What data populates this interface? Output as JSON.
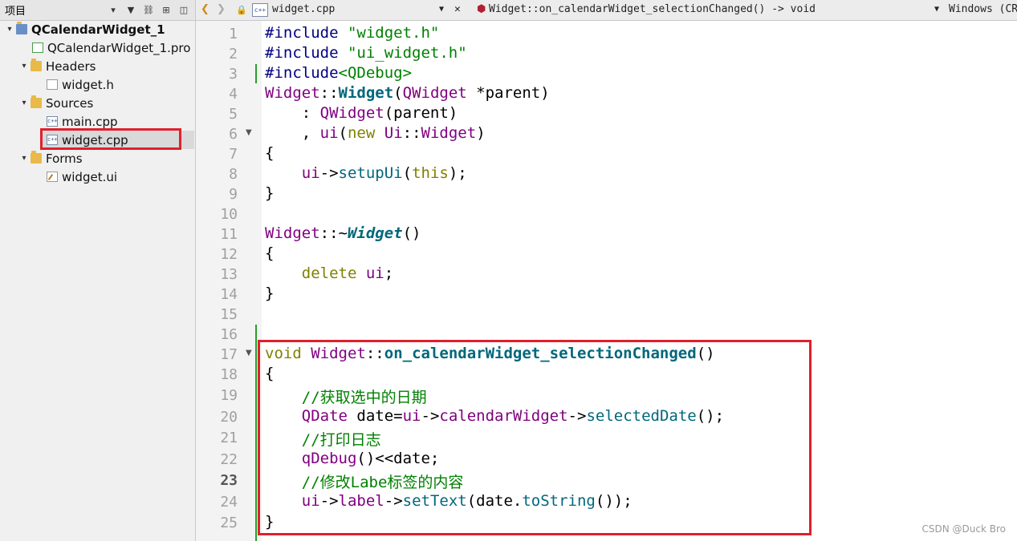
{
  "project_panel": {
    "title": "项目",
    "tree": [
      {
        "label": "QCalendarWidget_1",
        "icon": "project-icon",
        "arrow": "▾"
      },
      {
        "label": "QCalendarWidget_1.pro",
        "icon": "pro-file-icon"
      },
      {
        "label": "Headers",
        "icon": "folder-icon",
        "arrow": "▾"
      },
      {
        "label": "widget.h",
        "icon": "header-file-icon"
      },
      {
        "label": "Sources",
        "icon": "folder-icon",
        "arrow": "▾"
      },
      {
        "label": "main.cpp",
        "icon": "cpp-file-icon"
      },
      {
        "label": "widget.cpp",
        "icon": "cpp-file-icon"
      },
      {
        "label": "Forms",
        "icon": "folder-icon",
        "arrow": "▾"
      },
      {
        "label": "widget.ui",
        "icon": "ui-file-icon"
      }
    ]
  },
  "editor": {
    "file_name": "widget.cpp",
    "function": "Widget::on_calendarWidget_selectionChanged() -> void",
    "encoding": "Windows (CR",
    "current_line": "23",
    "line_numbers": [
      "1",
      "2",
      "3",
      "4",
      "5",
      "6",
      "7",
      "8",
      "9",
      "10",
      "11",
      "12",
      "13",
      "14",
      "15",
      "16",
      "17",
      "18",
      "19",
      "20",
      "21",
      "22",
      "23",
      "24",
      "25"
    ],
    "code": {
      "l1_a": "#include ",
      "l1_b": "\"widget.h\"",
      "l2_a": "#include ",
      "l2_b": "\"ui_widget.h\"",
      "l3_a": "#include",
      "l3_b": "<QDebug>",
      "l4_a": "Widget",
      "l4_b": "::",
      "l4_c": "Widget",
      "l4_d": "(",
      "l4_e": "QWidget",
      "l4_f": " *parent)",
      "l5_a": "    : ",
      "l5_b": "QWidget",
      "l5_c": "(parent)",
      "l6_a": "    , ",
      "l6_b": "ui",
      "l6_c": "(",
      "l6_d": "new",
      "l6_e": " ",
      "l6_f": "Ui",
      "l6_g": "::",
      "l6_h": "Widget",
      "l6_i": ")",
      "l7": "{",
      "l8_a": "    ",
      "l8_b": "ui",
      "l8_c": "->",
      "l8_d": "setupUi",
      "l8_e": "(",
      "l8_f": "this",
      "l8_g": ");",
      "l9": "}",
      "l11_a": "Widget",
      "l11_b": "::~",
      "l11_c": "Widget",
      "l11_d": "()",
      "l12": "{",
      "l13_a": "    ",
      "l13_b": "delete",
      "l13_c": " ",
      "l13_d": "ui",
      "l13_e": ";",
      "l14": "}",
      "l17_a": "void",
      "l17_b": " ",
      "l17_c": "Widget",
      "l17_d": "::",
      "l17_e": "on_calendarWidget_selectionChanged",
      "l17_f": "()",
      "l18": "{",
      "l19": "    //获取选中的日期",
      "l20_a": "    ",
      "l20_b": "QDate",
      "l20_c": " date=",
      "l20_d": "ui",
      "l20_e": "->",
      "l20_f": "calendarWidget",
      "l20_g": "->",
      "l20_h": "selectedDate",
      "l20_i": "();",
      "l21": "    //打印日志",
      "l22_a": "    ",
      "l22_b": "qDebug",
      "l22_c": "()<<date;",
      "l23": "    //修改Labe标签的内容",
      "l24_a": "    ",
      "l24_b": "ui",
      "l24_c": "->",
      "l24_d": "label",
      "l24_e": "->",
      "l24_f": "setText",
      "l24_g": "(date.",
      "l24_h": "toString",
      "l24_i": "());",
      "l25": "}"
    }
  },
  "watermark": "CSDN @Duck Bro"
}
